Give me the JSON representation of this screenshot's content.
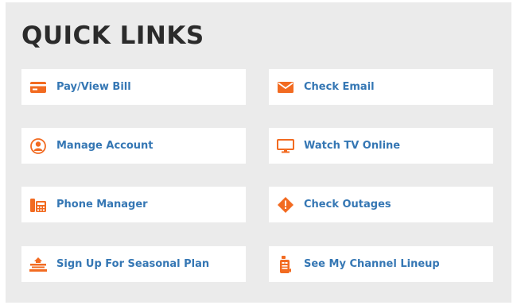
{
  "title": "QUICK LINKS",
  "accent_color": "#f26b21",
  "link_color": "#3577b4",
  "links": [
    {
      "label": "Pay/View Bill",
      "icon": "credit-card-icon"
    },
    {
      "label": "Check Email",
      "icon": "envelope-icon"
    },
    {
      "label": "Manage Account",
      "icon": "user-circle-icon"
    },
    {
      "label": "Watch TV Online",
      "icon": "monitor-icon"
    },
    {
      "label": "Phone Manager",
      "icon": "phone-icon"
    },
    {
      "label": "Check Outages",
      "icon": "warning-diamond-icon"
    },
    {
      "label": "Sign Up For Seasonal Plan",
      "icon": "seasonal-plan-icon"
    },
    {
      "label": "See My Channel Lineup",
      "icon": "remote-control-icon"
    }
  ]
}
